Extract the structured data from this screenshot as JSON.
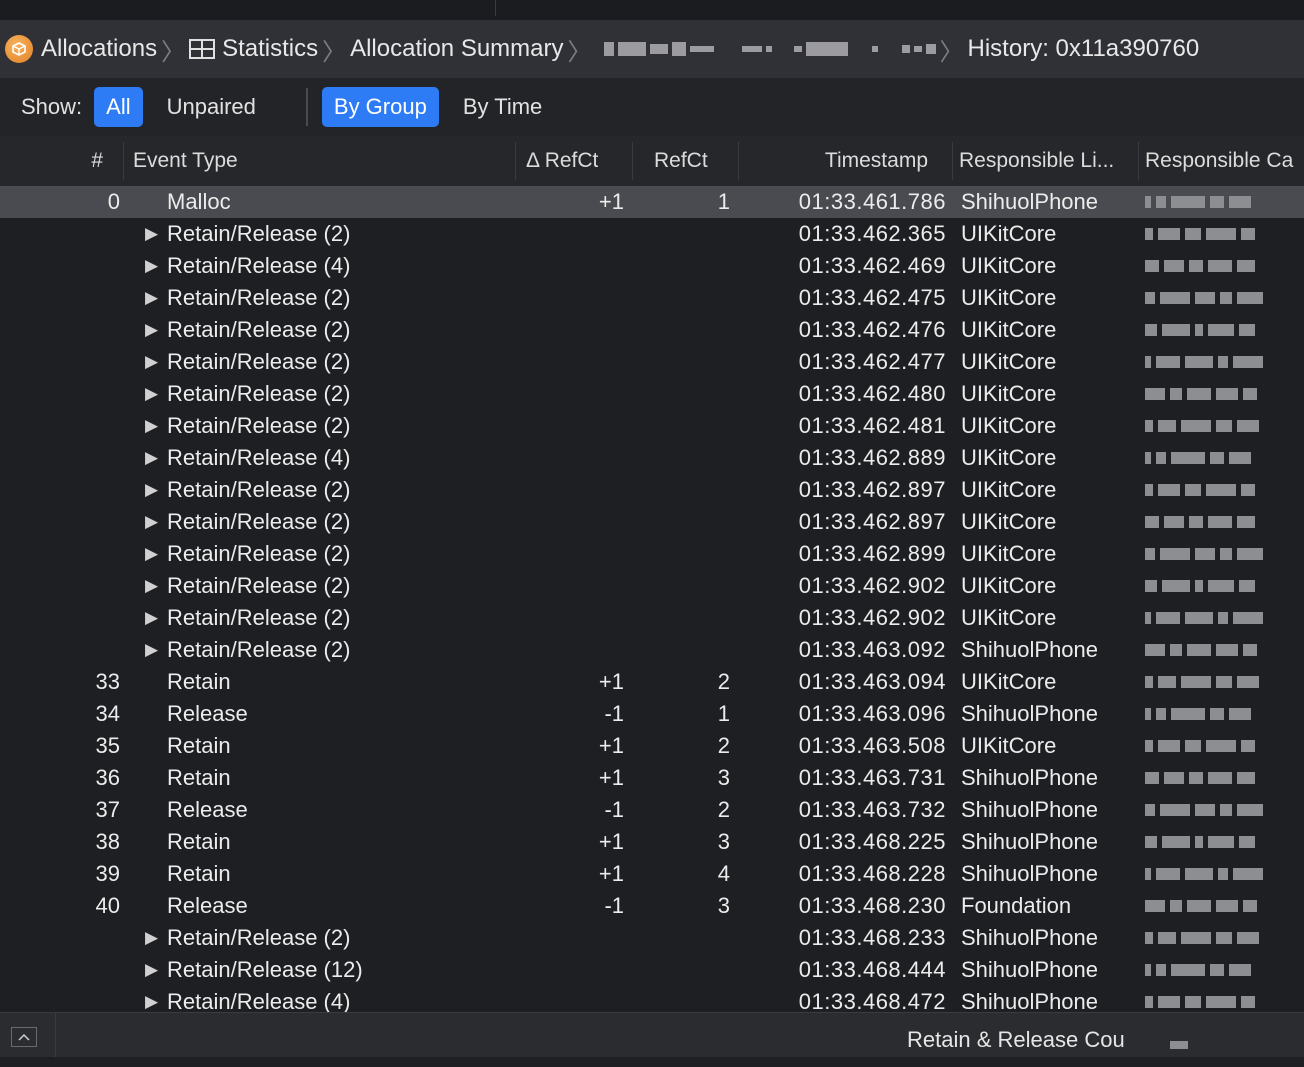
{
  "breadcrumb": {
    "app": "Allocations",
    "statistics": "Statistics",
    "summary": "Allocation Summary",
    "history": "History: 0x11a390760"
  },
  "filter": {
    "show_label": "Show:",
    "all": "All",
    "unpaired": "Unpaired",
    "by_group": "By Group",
    "by_time": "By Time"
  },
  "columns": {
    "num": "#",
    "event": "Event Type",
    "delta": "Δ RefCt",
    "refct": "RefCt",
    "timestamp": "Timestamp",
    "library": "Responsible Li...",
    "caller": "Responsible Ca"
  },
  "rows": [
    {
      "num": "0",
      "group": false,
      "event": "Malloc",
      "delta": "+1",
      "refct": "1",
      "time": "01:33.461.786",
      "lib": "ShihuolPhone"
    },
    {
      "num": "",
      "group": true,
      "event": "Retain/Release (2)",
      "delta": "",
      "refct": "",
      "time": "01:33.462.365",
      "lib": "UIKitCore"
    },
    {
      "num": "",
      "group": true,
      "event": "Retain/Release (4)",
      "delta": "",
      "refct": "",
      "time": "01:33.462.469",
      "lib": "UIKitCore"
    },
    {
      "num": "",
      "group": true,
      "event": "Retain/Release (2)",
      "delta": "",
      "refct": "",
      "time": "01:33.462.475",
      "lib": "UIKitCore"
    },
    {
      "num": "",
      "group": true,
      "event": "Retain/Release (2)",
      "delta": "",
      "refct": "",
      "time": "01:33.462.476",
      "lib": "UIKitCore"
    },
    {
      "num": "",
      "group": true,
      "event": "Retain/Release (2)",
      "delta": "",
      "refct": "",
      "time": "01:33.462.477",
      "lib": "UIKitCore"
    },
    {
      "num": "",
      "group": true,
      "event": "Retain/Release (2)",
      "delta": "",
      "refct": "",
      "time": "01:33.462.480",
      "lib": "UIKitCore"
    },
    {
      "num": "",
      "group": true,
      "event": "Retain/Release (2)",
      "delta": "",
      "refct": "",
      "time": "01:33.462.481",
      "lib": "UIKitCore"
    },
    {
      "num": "",
      "group": true,
      "event": "Retain/Release (4)",
      "delta": "",
      "refct": "",
      "time": "01:33.462.889",
      "lib": "UIKitCore"
    },
    {
      "num": "",
      "group": true,
      "event": "Retain/Release (2)",
      "delta": "",
      "refct": "",
      "time": "01:33.462.897",
      "lib": "UIKitCore"
    },
    {
      "num": "",
      "group": true,
      "event": "Retain/Release (2)",
      "delta": "",
      "refct": "",
      "time": "01:33.462.897",
      "lib": "UIKitCore"
    },
    {
      "num": "",
      "group": true,
      "event": "Retain/Release (2)",
      "delta": "",
      "refct": "",
      "time": "01:33.462.899",
      "lib": "UIKitCore"
    },
    {
      "num": "",
      "group": true,
      "event": "Retain/Release (2)",
      "delta": "",
      "refct": "",
      "time": "01:33.462.902",
      "lib": "UIKitCore"
    },
    {
      "num": "",
      "group": true,
      "event": "Retain/Release (2)",
      "delta": "",
      "refct": "",
      "time": "01:33.462.902",
      "lib": "UIKitCore"
    },
    {
      "num": "",
      "group": true,
      "event": "Retain/Release (2)",
      "delta": "",
      "refct": "",
      "time": "01:33.463.092",
      "lib": "ShihuolPhone"
    },
    {
      "num": "33",
      "group": false,
      "event": "Retain",
      "delta": "+1",
      "refct": "2",
      "time": "01:33.463.094",
      "lib": "UIKitCore"
    },
    {
      "num": "34",
      "group": false,
      "event": "Release",
      "delta": "-1",
      "refct": "1",
      "time": "01:33.463.096",
      "lib": "ShihuolPhone"
    },
    {
      "num": "35",
      "group": false,
      "event": "Retain",
      "delta": "+1",
      "refct": "2",
      "time": "01:33.463.508",
      "lib": "UIKitCore"
    },
    {
      "num": "36",
      "group": false,
      "event": "Retain",
      "delta": "+1",
      "refct": "3",
      "time": "01:33.463.731",
      "lib": "ShihuolPhone"
    },
    {
      "num": "37",
      "group": false,
      "event": "Release",
      "delta": "-1",
      "refct": "2",
      "time": "01:33.463.732",
      "lib": "ShihuolPhone"
    },
    {
      "num": "38",
      "group": false,
      "event": "Retain",
      "delta": "+1",
      "refct": "3",
      "time": "01:33.468.225",
      "lib": "ShihuolPhone"
    },
    {
      "num": "39",
      "group": false,
      "event": "Retain",
      "delta": "+1",
      "refct": "4",
      "time": "01:33.468.228",
      "lib": "ShihuolPhone"
    },
    {
      "num": "40",
      "group": false,
      "event": "Release",
      "delta": "-1",
      "refct": "3",
      "time": "01:33.468.230",
      "lib": "Foundation"
    },
    {
      "num": "",
      "group": true,
      "event": "Retain/Release (2)",
      "delta": "",
      "refct": "",
      "time": "01:33.468.233",
      "lib": "ShihuolPhone"
    },
    {
      "num": "",
      "group": true,
      "event": "Retain/Release (12)",
      "delta": "",
      "refct": "",
      "time": "01:33.468.444",
      "lib": "ShihuolPhone"
    },
    {
      "num": "",
      "group": true,
      "event": "Retain/Release (4)",
      "delta": "",
      "refct": "",
      "time": "01:33.468.472",
      "lib": "ShihuolPhone"
    }
  ],
  "status": {
    "text": "Retain & Release Cou"
  }
}
